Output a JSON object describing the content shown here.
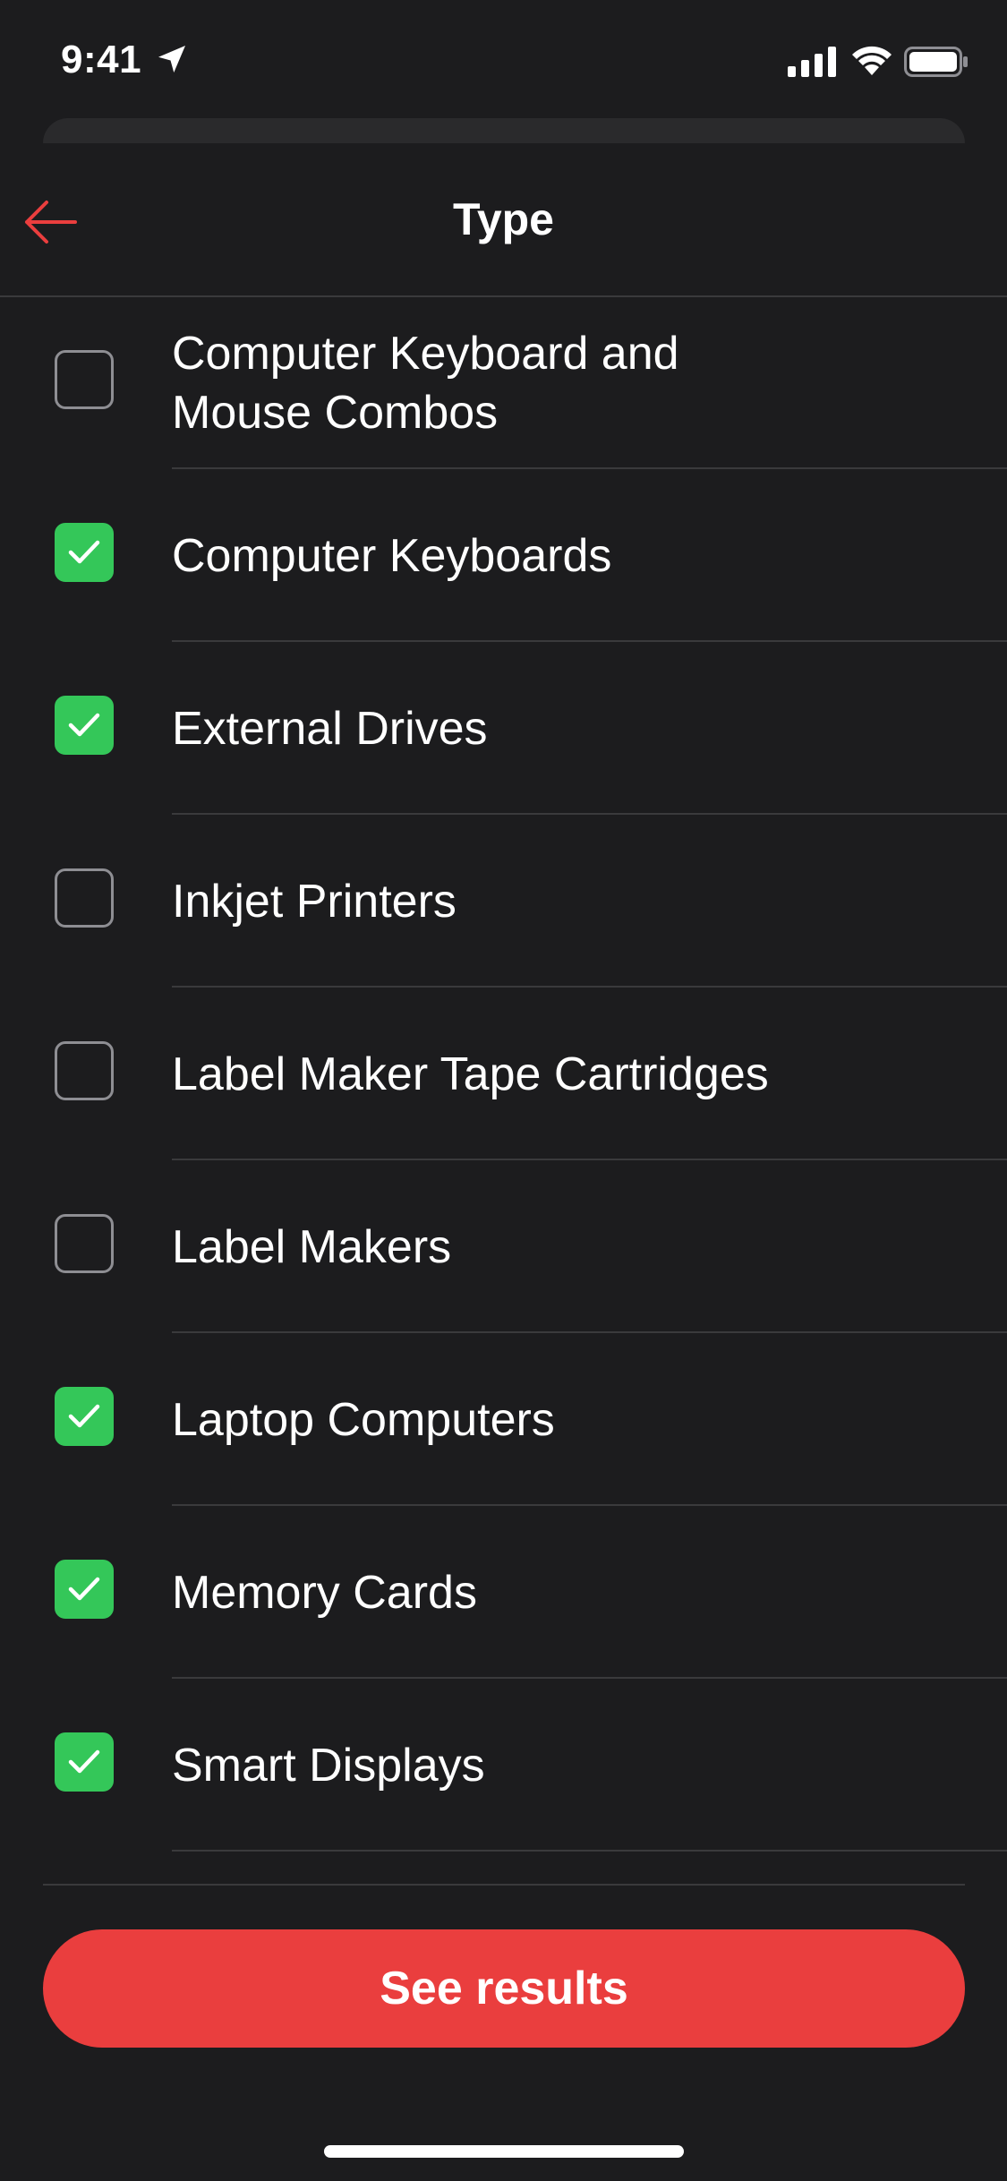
{
  "status_bar": {
    "time": "9:41"
  },
  "header": {
    "title": "Type",
    "back_icon": "arrow-left-icon"
  },
  "colors": {
    "background": "#1c1c1e",
    "accent_red": "#ea3e3e",
    "checked_green": "#34c759",
    "divider": "#3a3a3c"
  },
  "items": [
    {
      "label": "Computer Keyboard and Mouse Combos",
      "checked": false
    },
    {
      "label": "Computer Keyboards",
      "checked": true
    },
    {
      "label": "External Drives",
      "checked": true
    },
    {
      "label": "Inkjet Printers",
      "checked": false
    },
    {
      "label": "Label Maker Tape Cartridges",
      "checked": false
    },
    {
      "label": "Label Makers",
      "checked": false
    },
    {
      "label": "Laptop Computers",
      "checked": true
    },
    {
      "label": "Memory Cards",
      "checked": true
    },
    {
      "label": "Smart Displays",
      "checked": true
    }
  ],
  "footer": {
    "button_label": "See results"
  }
}
